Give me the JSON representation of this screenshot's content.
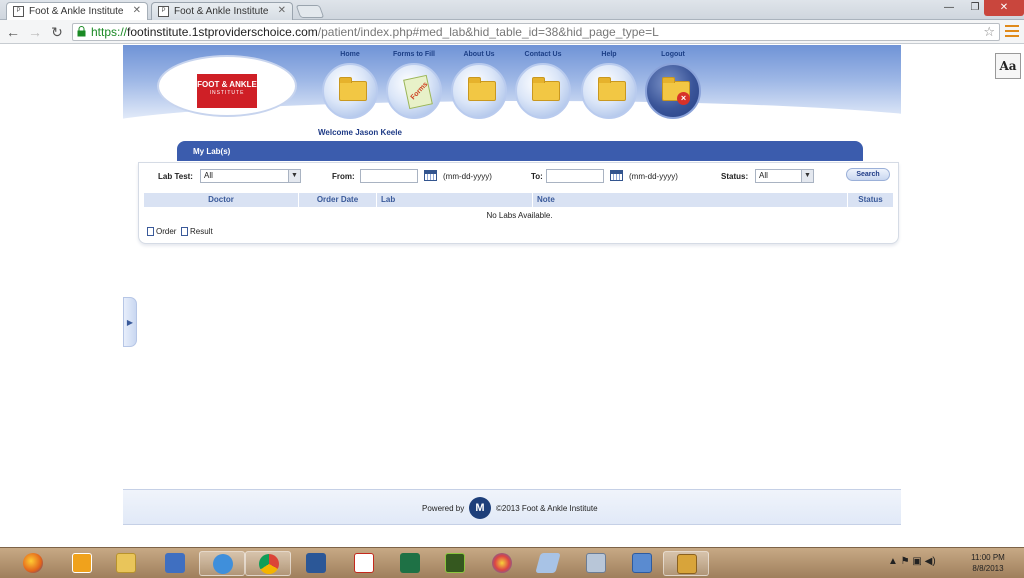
{
  "browser": {
    "tabs": [
      {
        "title": "Foot & Ankle Institute",
        "active": true
      },
      {
        "title": "Foot & Ankle Institute",
        "active": false
      }
    ],
    "url": {
      "scheme": "https://",
      "host": "footinstitute.1stproviderschoice.com",
      "path": "/patient/index.php#med_lab&hid_table_id=38&hid_page_type=L"
    },
    "font_button": "Aa"
  },
  "header": {
    "logo": {
      "line1": "FOOT & ANKLE",
      "line2": "INSTITUTE"
    },
    "nav": [
      {
        "label": "Home",
        "icon": "home-folder-icon"
      },
      {
        "label": "Forms to Fill",
        "icon": "forms-icon",
        "icon_text": "Forms"
      },
      {
        "label": "About Us",
        "icon": "about-folder-icon"
      },
      {
        "label": "Contact Us",
        "icon": "contact-folder-icon"
      },
      {
        "label": "Help",
        "icon": "help-folder-icon"
      },
      {
        "label": "Logout",
        "icon": "logout-folder-icon"
      }
    ],
    "welcome": "Welcome Jason Keele"
  },
  "section": {
    "title": "My Lab(s)"
  },
  "filters": {
    "lab_test_label": "Lab Test:",
    "lab_test_value": "All",
    "from_label": "From:",
    "from_value": "",
    "date_hint": "(mm-dd-yyyy)",
    "to_label": "To:",
    "to_value": "",
    "status_label": "Status:",
    "status_value": "All",
    "search_label": "Search"
  },
  "table": {
    "columns": [
      "Doctor",
      "Order Date",
      "Lab",
      "Note",
      "Status"
    ],
    "empty_message": "No Labs Available."
  },
  "legend": {
    "order": "Order",
    "result": "Result"
  },
  "footer": {
    "powered_by": "Powered by",
    "logo_letter": "M",
    "copyright": "©2013 Foot & Ankle Institute"
  },
  "taskbar": {
    "apps": [
      "firefox",
      "outlook",
      "explorer",
      "network",
      "internet-explorer",
      "chrome",
      "word",
      "acrobat",
      "excel",
      "dreamweaver",
      "paint",
      "notepad",
      "calculator",
      "remote-desktop",
      "archive"
    ],
    "time": "11:00 PM",
    "date": "8/8/2013"
  },
  "colors": {
    "accent": "#3b5cad",
    "logo_red": "#cf1f26",
    "chrome_green": "#1a8a24"
  }
}
